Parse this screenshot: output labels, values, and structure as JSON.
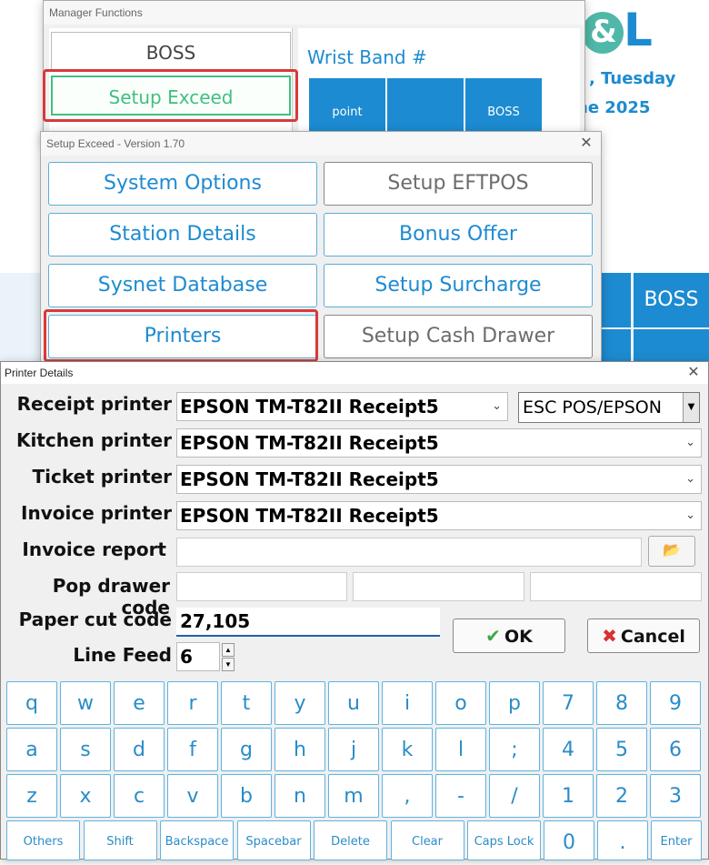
{
  "background": {
    "logo_left": "",
    "logo_amp": "&",
    "logo_right": "L",
    "date_line1": ", Tuesday",
    "date_line2": "ne 2025",
    "tile_label": "BOSS"
  },
  "manager": {
    "title": "Manager Functions",
    "boss_label": "BOSS",
    "setup_label": "Setup Exceed",
    "wrist_label": "Wrist Band #",
    "tiles": [
      "point",
      "",
      "BOSS"
    ]
  },
  "setup": {
    "title": "Setup Exceed - Version 1.70",
    "buttons_left": [
      "System Options",
      "Station Details",
      "Sysnet Database",
      "Printers"
    ],
    "buttons_right": [
      "Setup EFTPOS",
      "Bonus Offer",
      "Setup Surcharge",
      "Setup Cash Drawer"
    ]
  },
  "printer": {
    "title": "Printer Details",
    "labels": {
      "receipt": "Receipt printer",
      "kitchen": "Kitchen printer",
      "ticket": "Ticket printer",
      "invoice": "Invoice printer",
      "invoice_report": "Invoice report",
      "pop_drawer": "Pop drawer code",
      "paper_cut": "Paper cut code",
      "line_feed": "Line Feed"
    },
    "values": {
      "receipt": "EPSON TM-T82II Receipt5",
      "kitchen": "EPSON TM-T82II Receipt5",
      "ticket": "EPSON TM-T82II Receipt5",
      "invoice": "EPSON TM-T82II Receipt5",
      "invoice_report": "",
      "pop_drawer": [
        "",
        "",
        ""
      ],
      "paper_cut": "27,105",
      "line_feed": "6"
    },
    "esc_option": "ESC POS/EPSON",
    "ok_label": "OK",
    "cancel_label": "Cancel"
  },
  "keyboard": {
    "row1": [
      "q",
      "w",
      "e",
      "r",
      "t",
      "y",
      "u",
      "i",
      "o",
      "p",
      "7",
      "8",
      "9"
    ],
    "row2": [
      "a",
      "s",
      "d",
      "f",
      "g",
      "h",
      "j",
      "k",
      "l",
      ";",
      "4",
      "5",
      "6"
    ],
    "row3": [
      "z",
      "x",
      "c",
      "v",
      "b",
      "n",
      "m",
      ",",
      "-",
      "/",
      "1",
      "2",
      "3"
    ],
    "row4": [
      "Others",
      "Shift",
      "Backspace",
      "Spacebar",
      "Delete",
      "Clear",
      "Caps Lock",
      "0",
      ".",
      "Enter"
    ]
  },
  "colors": {
    "accent": "#1d8bd1",
    "highlight": "#d83a3a",
    "setup_green": "#3fbf7f"
  }
}
